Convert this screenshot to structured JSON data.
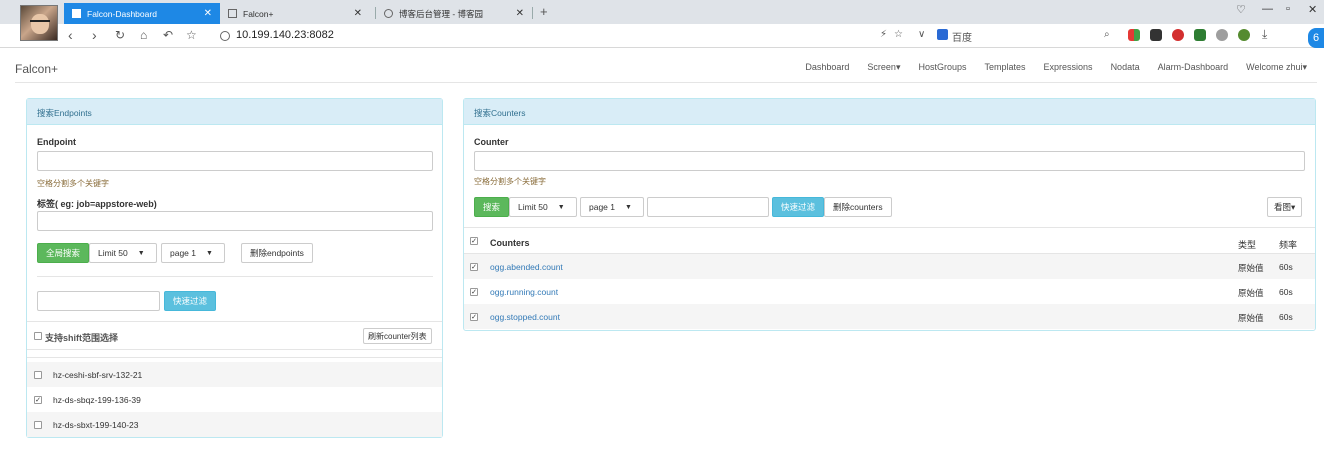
{
  "browser": {
    "tabs": [
      {
        "title": "Falcon-Dashboard",
        "active": true
      },
      {
        "title": "Falcon+",
        "active": false
      },
      {
        "title": "博客后台管理 - 博客园",
        "active": false
      }
    ],
    "url": "10.199.140.23:8082",
    "search_engine": "百度",
    "new_tab": "+",
    "controls": {
      "minimize": "—",
      "maximize": "▫",
      "close": "✕"
    }
  },
  "navbar": {
    "brand": "Falcon+",
    "links": [
      "Dashboard",
      "Screen▾",
      "HostGroups",
      "Templates",
      "Expressions",
      "Nodata",
      "Alarm-Dashboard",
      "Welcome zhui▾"
    ]
  },
  "endpoints": {
    "heading": "搜索Endpoints",
    "endpoint_label": "Endpoint",
    "endpoint_value": "",
    "help": "空格分割多个关键字",
    "tag_label": "标签( eg: job=appstore-web)",
    "tag_value": "",
    "search_button": "全局搜索",
    "limit": "Limit 50",
    "page": "page 1",
    "delete_button": "删除endpoints",
    "filter_value": "",
    "filter_button": "快速过滤",
    "shift_label": "支持shift范围选择",
    "refresh_button": "刷新counter列表",
    "items": [
      {
        "name": "hz-ceshi-sbf-srv-132-21",
        "checked": false
      },
      {
        "name": "hz-ds-sbqz-199-136-39",
        "checked": true
      },
      {
        "name": "hz-ds-sbxt-199-140-23",
        "checked": false
      }
    ]
  },
  "counters": {
    "heading": "搜索Counters",
    "counter_label": "Counter",
    "counter_value": "",
    "help": "空格分割多个关键字",
    "search_button": "搜索",
    "limit": "Limit 50",
    "page": "page 1",
    "filter_value": "",
    "filter_button": "快速过滤",
    "delete_button": "删除counters",
    "view_button": "看图▾",
    "columns": {
      "name": "Counters",
      "type": "类型",
      "freq": "频率"
    },
    "rows": [
      {
        "name": "ogg.abended.count",
        "type": "原始值",
        "freq": "60s",
        "checked": true
      },
      {
        "name": "ogg.running.count",
        "type": "原始值",
        "freq": "60s",
        "checked": true
      },
      {
        "name": "ogg.stopped.count",
        "type": "原始值",
        "freq": "60s",
        "checked": true
      }
    ]
  },
  "colors": {
    "active_tab": "#1e88e5",
    "panel_heading": "#d9edf7",
    "btn_green": "#5cb85c",
    "btn_cyan": "#5bc0de",
    "link": "#337ab7"
  }
}
